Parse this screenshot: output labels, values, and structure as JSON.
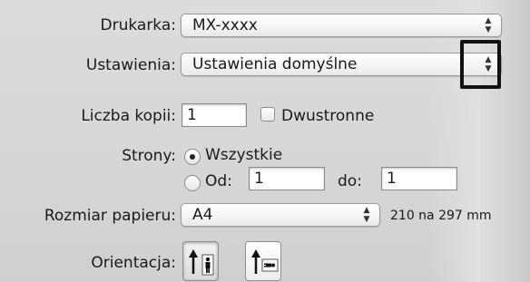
{
  "printer": {
    "label": "Drukarka:",
    "value": "MX-xxxx"
  },
  "presets": {
    "label": "Ustawienia:",
    "value": "Ustawienia domyślne"
  },
  "copies": {
    "label": "Liczba kopii:",
    "value": "1",
    "duplex_label": "Dwustronne",
    "duplex_checked": false
  },
  "pages": {
    "label": "Strony:",
    "all_label": "Wszystkie",
    "from_label": "Od:",
    "from_value": "1",
    "to_label": "do:",
    "to_value": "1",
    "selected": "all"
  },
  "paper": {
    "label": "Rozmiar papieru:",
    "value": "A4",
    "dimensions": "210 na 297 mm"
  },
  "orientation": {
    "label": "Orientacja:",
    "selected": "portrait"
  },
  "icons": {
    "popup_arrows": "up-down-chevrons-icon",
    "portrait": "portrait-orientation-icon",
    "landscape": "landscape-orientation-icon"
  },
  "colors": {
    "highlight_border": "#111111",
    "background": "#d8d8d8"
  }
}
